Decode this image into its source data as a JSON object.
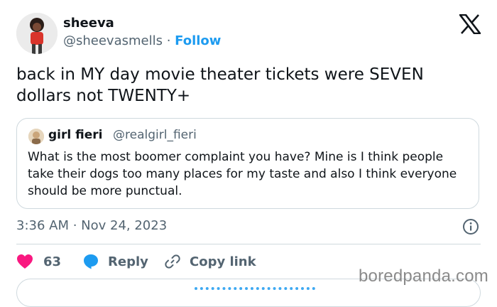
{
  "author": {
    "name": "sheeva",
    "handle": "@sheevasmells",
    "separator": " · ",
    "follow_label": "Follow"
  },
  "tweet_text": "back in MY day movie theater tickets were SEVEN dollars not TWENTY+",
  "quoted": {
    "name": "girl fieri",
    "handle": "@realgirl_fieri",
    "text": "What is the most boomer complaint you have? Mine is I think people take their dogs too many places for my taste and also I think everyone should be more punctual."
  },
  "timestamp": "3:36 AM · Nov 24, 2023",
  "actions": {
    "like_count": "63",
    "reply_label": "Reply",
    "copy_link_label": "Copy link"
  },
  "watermark": "boredpanda.com",
  "icons": {
    "platform": "x-logo-icon",
    "like": "heart-icon",
    "reply": "speech-bubble-icon",
    "copy": "link-icon",
    "info": "info-icon"
  },
  "colors": {
    "accent": "#1d9bf0",
    "like": "#f91880",
    "text": "#0f1419",
    "secondary": "#536471",
    "border": "#cfd9de"
  }
}
